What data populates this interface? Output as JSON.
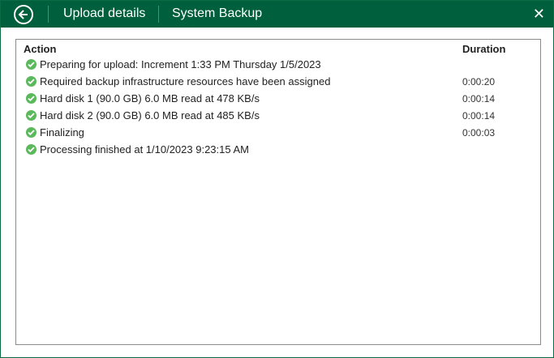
{
  "header": {
    "title": "Upload details",
    "subtitle": "System Backup"
  },
  "table": {
    "columns": [
      "Action",
      "Duration"
    ],
    "rows": [
      {
        "action": "Preparing for upload: Increment 1:33 PM Thursday 1/5/2023",
        "duration": ""
      },
      {
        "action": "Required backup infrastructure resources have been assigned",
        "duration": "0:00:20"
      },
      {
        "action": "Hard disk 1 (90.0 GB) 6.0 MB read at 478 KB/s",
        "duration": "0:00:14"
      },
      {
        "action": "Hard disk 2 (90.0 GB) 6.0 MB read at 485 KB/s",
        "duration": "0:00:14"
      },
      {
        "action": "Finalizing",
        "duration": "0:00:03"
      },
      {
        "action": "Processing finished at 1/10/2023 9:23:15 AM",
        "duration": ""
      }
    ]
  }
}
